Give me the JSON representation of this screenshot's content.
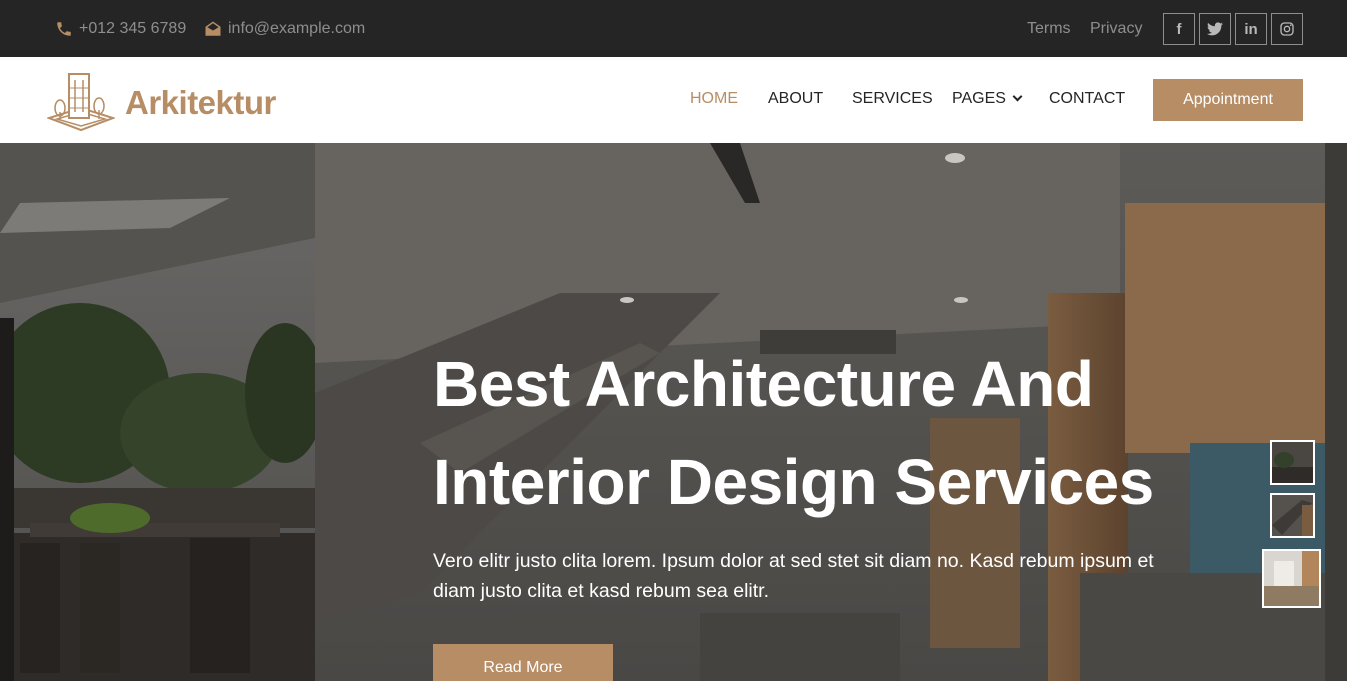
{
  "topbar": {
    "phone": "+012 345 6789",
    "email": "info@example.com",
    "links": [
      "Terms",
      "Privacy"
    ],
    "social": [
      {
        "icon": "facebook-icon",
        "glyph": "f"
      },
      {
        "icon": "twitter-icon",
        "glyph": "🐦"
      },
      {
        "icon": "linkedin-icon",
        "glyph": "in"
      },
      {
        "icon": "instagram-icon",
        "glyph": "◎"
      }
    ]
  },
  "navbar": {
    "brand": "Arkitektur",
    "items": [
      "HOME",
      "ABOUT",
      "SERVICES",
      "PAGES",
      "CONTACT"
    ],
    "active": "HOME",
    "cta": "Appointment"
  },
  "hero": {
    "title_line1": "Best Architecture And",
    "title_line2": "Interior Design Services",
    "text": "Vero elitr justo clita lorem. Ipsum dolor at sed stet sit diam no. Kasd rebum ipsum et diam justo clita et kasd rebum sea elitr.",
    "button": "Read More"
  },
  "colors": {
    "accent": "#b78d65",
    "topbar_bg": "#252525",
    "dark_text": "#252525"
  }
}
